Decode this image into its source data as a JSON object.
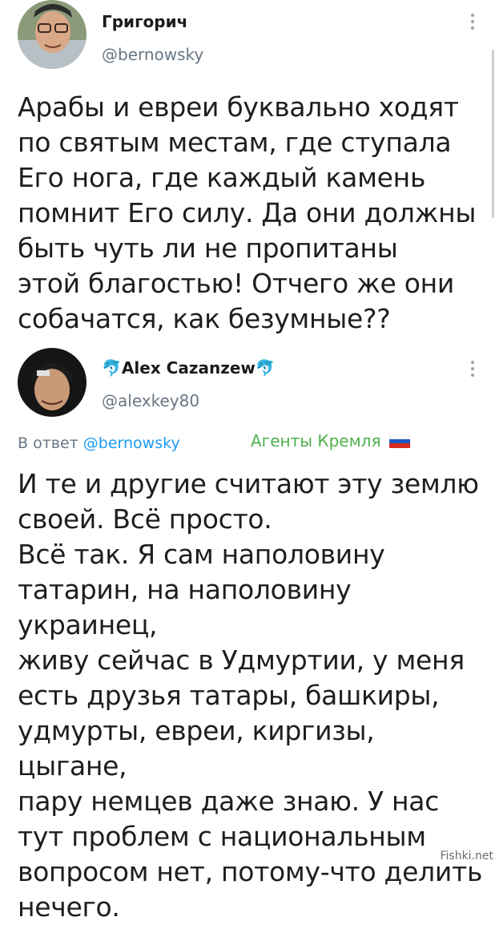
{
  "tweet1": {
    "author": "Григорич",
    "handle": "@bernowsky",
    "text": "Арабы и евреи буквально ходят\nпо святым местам, где ступала\nЕго нога, где каждый камень\nпомнит Его силу. Да они должны\nбыть чуть ли не пропитаны\nэтой благостью! Отчего же они\nсобачатся, как безумные??"
  },
  "tweet2": {
    "author": "Alex Cazanzew",
    "handle": "@alexkey80",
    "reply_prefix": "В ответ",
    "reply_mention": "@bernowsky",
    "badge": "Агенты Кремля",
    "text": "И те и другие считают эту землю\nсвоей. Всё просто.\nВсё так. Я сам наполовину\nтатарин, на наполовину украинец,\nживу сейчас в Удмуртии, у меня\nесть друзья татары, башкиры,\nудмурты, евреи, киргизы,  цыгане,\nпару немцев даже знаю. У нас\nтут проблем с национальным\nвопросом нет, потому-что делить\nнечего."
  },
  "watermark": "Fishki.net",
  "icons": {
    "more": "more-vertical-icon",
    "dolphin": "dolphin-emoji-icon",
    "flag": "russia-flag-icon"
  },
  "colors": {
    "link": "#1d9bf0",
    "secondary": "#687684",
    "badge": "#4fb04f"
  }
}
